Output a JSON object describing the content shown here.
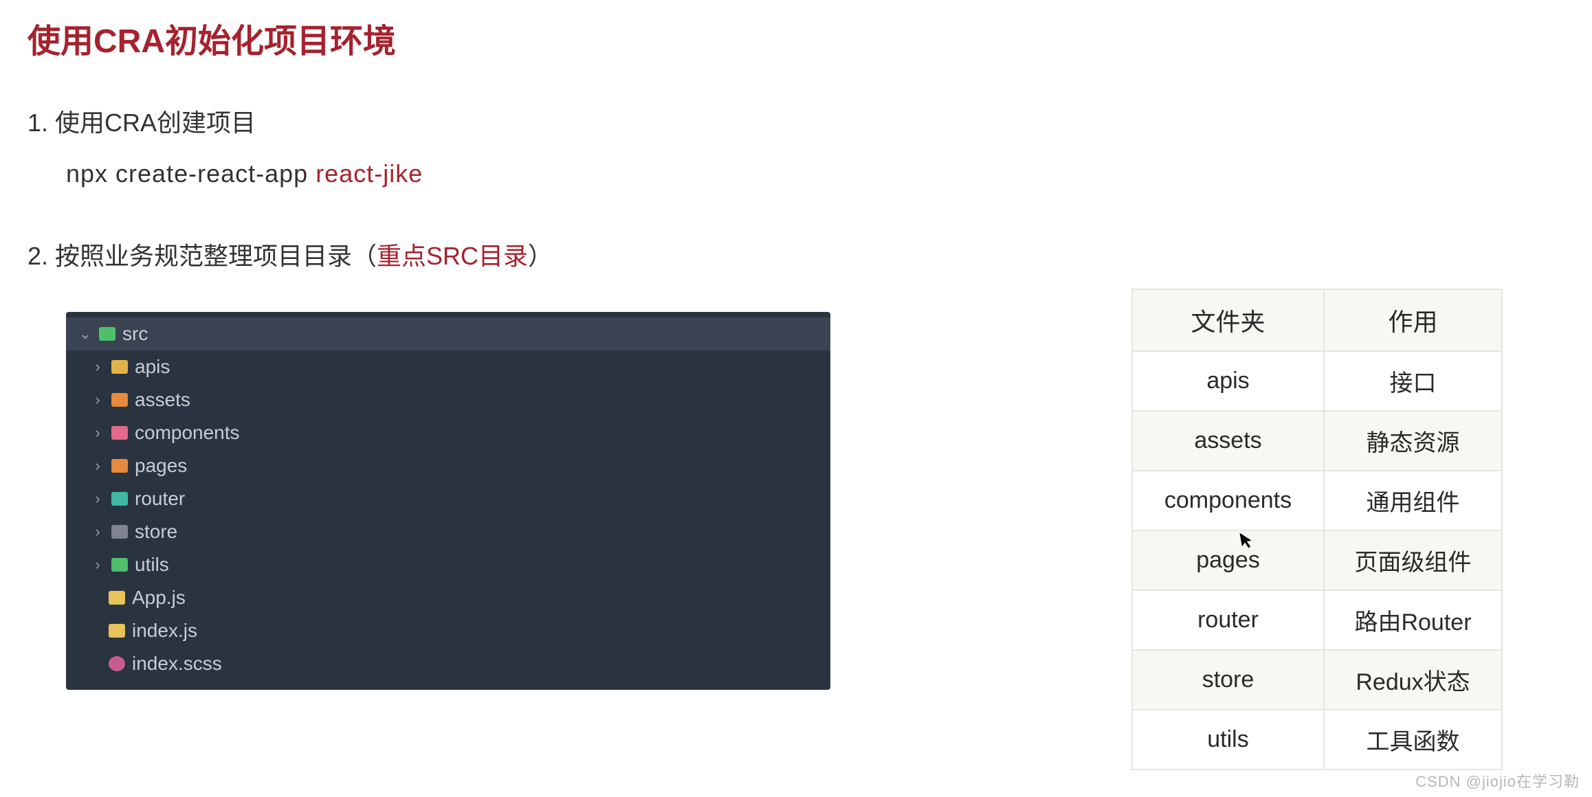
{
  "title": "使用CRA初始化项目环境",
  "section1": {
    "heading": "1. 使用CRA创建项目",
    "command_prefix": "npx  create-react-app ",
    "command_arg": "react-jike"
  },
  "section2": {
    "heading_prefix": "2. 按照业务规范整理项目目录（",
    "heading_highlight": "重点SRC目录",
    "heading_suffix": "）"
  },
  "tree": {
    "root": "src",
    "items": [
      {
        "name": "apis",
        "icon": "icon-folder-yellow",
        "chevron": "›"
      },
      {
        "name": "assets",
        "icon": "icon-folder-orange",
        "chevron": "›"
      },
      {
        "name": "components",
        "icon": "icon-folder-pink",
        "chevron": "›"
      },
      {
        "name": "pages",
        "icon": "icon-folder-orange",
        "chevron": "›"
      },
      {
        "name": "router",
        "icon": "icon-folder-teal",
        "chevron": "›"
      },
      {
        "name": "store",
        "icon": "icon-folder-gray",
        "chevron": "›"
      },
      {
        "name": "utils",
        "icon": "icon-folder-green",
        "chevron": "›"
      }
    ],
    "files": [
      {
        "name": "App.js",
        "icon": "icon-file-js"
      },
      {
        "name": "index.js",
        "icon": "icon-file-js"
      },
      {
        "name": "index.scss",
        "icon": "icon-file-scss"
      }
    ]
  },
  "table": {
    "headers": [
      "文件夹",
      "作用"
    ],
    "rows": [
      {
        "folder": "apis",
        "desc": "接口"
      },
      {
        "folder": "assets",
        "desc": "静态资源"
      },
      {
        "folder": "components",
        "desc": "通用组件"
      },
      {
        "folder": "pages",
        "desc": "页面级组件"
      },
      {
        "folder": "router",
        "desc": "路由Router"
      },
      {
        "folder": "store",
        "desc": "Redux状态"
      },
      {
        "folder": "utils",
        "desc": "工具函数"
      }
    ]
  },
  "watermark": "CSDN @jiojio在学习勒"
}
